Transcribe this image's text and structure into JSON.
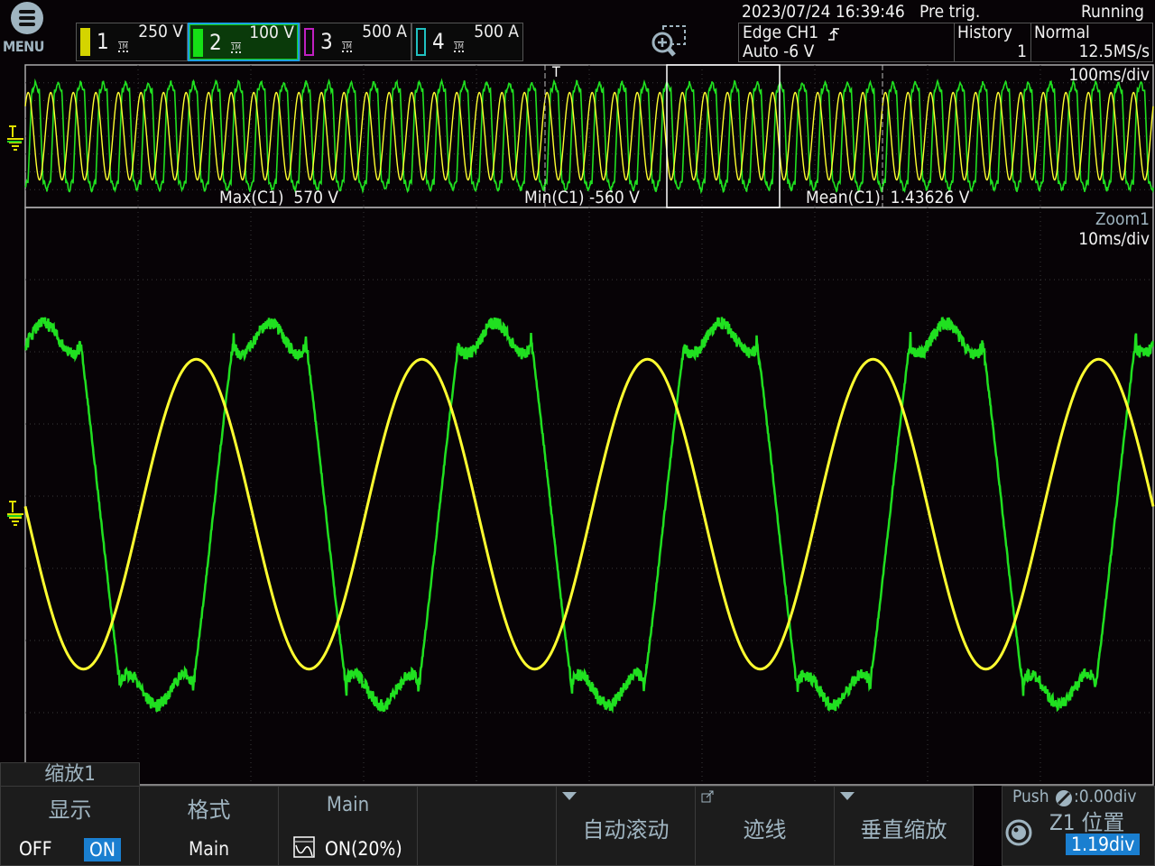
{
  "menu": {
    "label": "MENU",
    "icon": "hamburger-icon"
  },
  "channels": [
    {
      "num": "1",
      "scale": "250 V",
      "impedance": "1M",
      "color": "#d4d400",
      "enabled": true,
      "selected": false
    },
    {
      "num": "2",
      "scale": "100 V",
      "impedance": "1M",
      "color": "#16e016",
      "enabled": true,
      "selected": true
    },
    {
      "num": "3",
      "scale": "500 A",
      "impedance": "1M",
      "color": "#c020c0",
      "enabled": false,
      "selected": false
    },
    {
      "num": "4",
      "scale": "500 A",
      "impedance": "1M",
      "color": "#20c0c0",
      "enabled": false,
      "selected": false
    }
  ],
  "header": {
    "datetime": "2023/07/24 16:39:46",
    "trigger_mode_text": "Pre trig.",
    "run_status": "Running",
    "trigger_type": "Edge CH1",
    "trigger_slope_icon": "rising-edge-icon",
    "trigger_level": "Auto -6 V",
    "history_label": "History",
    "history_value": "1",
    "acq_mode": "Normal",
    "sample_rate": "12.5MS/s",
    "zoom_icon": "zoom-area-icon"
  },
  "main_window": {
    "timebase": "100ms/div",
    "measurements": [
      {
        "label": "Max(C1)",
        "value": "570 V"
      },
      {
        "label": "Min(C1)",
        "value": "-560 V"
      },
      {
        "label": "Mean(C1)",
        "value": "1.43626 V"
      }
    ],
    "trigger_marker": "T"
  },
  "zoom_window": {
    "name": "Zoom1",
    "timebase": "10ms/div"
  },
  "colors": {
    "ch1": "#ffff30",
    "ch2": "#20e020",
    "accent": "#1a7fd0",
    "label": "#9fb4c0"
  },
  "softkeys": {
    "tab": "缩放1",
    "display": {
      "title": "显示",
      "off": "OFF",
      "on": "ON",
      "state": "ON"
    },
    "format": {
      "title": "格式",
      "value": "Main"
    },
    "main": {
      "title": "Main",
      "value": "ON(20%)"
    },
    "auto_scroll": "自动滚动",
    "trace": "迹线",
    "vertical_zoom": "垂直缩放",
    "knob": {
      "push": "Push",
      "push_value": ":0.00div",
      "title": "Z1 位置",
      "value": "1.19div"
    }
  }
}
